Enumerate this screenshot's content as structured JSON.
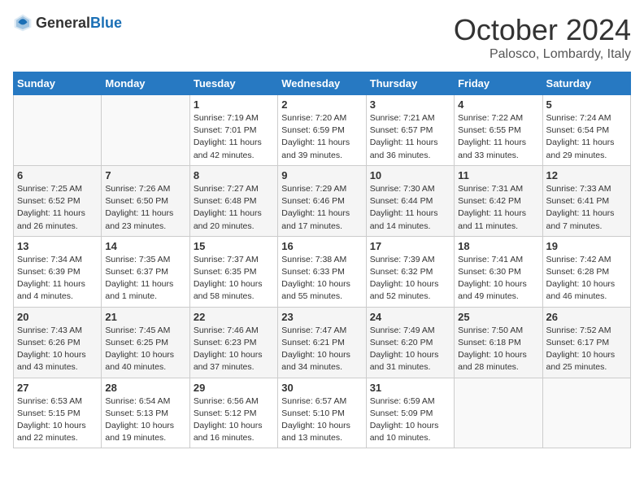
{
  "header": {
    "logo_general": "General",
    "logo_blue": "Blue",
    "month_title": "October 2024",
    "location": "Palosco, Lombardy, Italy"
  },
  "weekdays": [
    "Sunday",
    "Monday",
    "Tuesday",
    "Wednesday",
    "Thursday",
    "Friday",
    "Saturday"
  ],
  "weeks": [
    [
      {
        "day": "",
        "empty": true
      },
      {
        "day": "",
        "empty": true
      },
      {
        "day": "1",
        "sunrise": "Sunrise: 7:19 AM",
        "sunset": "Sunset: 7:01 PM",
        "daylight": "Daylight: 11 hours and 42 minutes."
      },
      {
        "day": "2",
        "sunrise": "Sunrise: 7:20 AM",
        "sunset": "Sunset: 6:59 PM",
        "daylight": "Daylight: 11 hours and 39 minutes."
      },
      {
        "day": "3",
        "sunrise": "Sunrise: 7:21 AM",
        "sunset": "Sunset: 6:57 PM",
        "daylight": "Daylight: 11 hours and 36 minutes."
      },
      {
        "day": "4",
        "sunrise": "Sunrise: 7:22 AM",
        "sunset": "Sunset: 6:55 PM",
        "daylight": "Daylight: 11 hours and 33 minutes."
      },
      {
        "day": "5",
        "sunrise": "Sunrise: 7:24 AM",
        "sunset": "Sunset: 6:54 PM",
        "daylight": "Daylight: 11 hours and 29 minutes."
      }
    ],
    [
      {
        "day": "6",
        "sunrise": "Sunrise: 7:25 AM",
        "sunset": "Sunset: 6:52 PM",
        "daylight": "Daylight: 11 hours and 26 minutes."
      },
      {
        "day": "7",
        "sunrise": "Sunrise: 7:26 AM",
        "sunset": "Sunset: 6:50 PM",
        "daylight": "Daylight: 11 hours and 23 minutes."
      },
      {
        "day": "8",
        "sunrise": "Sunrise: 7:27 AM",
        "sunset": "Sunset: 6:48 PM",
        "daylight": "Daylight: 11 hours and 20 minutes."
      },
      {
        "day": "9",
        "sunrise": "Sunrise: 7:29 AM",
        "sunset": "Sunset: 6:46 PM",
        "daylight": "Daylight: 11 hours and 17 minutes."
      },
      {
        "day": "10",
        "sunrise": "Sunrise: 7:30 AM",
        "sunset": "Sunset: 6:44 PM",
        "daylight": "Daylight: 11 hours and 14 minutes."
      },
      {
        "day": "11",
        "sunrise": "Sunrise: 7:31 AM",
        "sunset": "Sunset: 6:42 PM",
        "daylight": "Daylight: 11 hours and 11 minutes."
      },
      {
        "day": "12",
        "sunrise": "Sunrise: 7:33 AM",
        "sunset": "Sunset: 6:41 PM",
        "daylight": "Daylight: 11 hours and 7 minutes."
      }
    ],
    [
      {
        "day": "13",
        "sunrise": "Sunrise: 7:34 AM",
        "sunset": "Sunset: 6:39 PM",
        "daylight": "Daylight: 11 hours and 4 minutes."
      },
      {
        "day": "14",
        "sunrise": "Sunrise: 7:35 AM",
        "sunset": "Sunset: 6:37 PM",
        "daylight": "Daylight: 11 hours and 1 minute."
      },
      {
        "day": "15",
        "sunrise": "Sunrise: 7:37 AM",
        "sunset": "Sunset: 6:35 PM",
        "daylight": "Daylight: 10 hours and 58 minutes."
      },
      {
        "day": "16",
        "sunrise": "Sunrise: 7:38 AM",
        "sunset": "Sunset: 6:33 PM",
        "daylight": "Daylight: 10 hours and 55 minutes."
      },
      {
        "day": "17",
        "sunrise": "Sunrise: 7:39 AM",
        "sunset": "Sunset: 6:32 PM",
        "daylight": "Daylight: 10 hours and 52 minutes."
      },
      {
        "day": "18",
        "sunrise": "Sunrise: 7:41 AM",
        "sunset": "Sunset: 6:30 PM",
        "daylight": "Daylight: 10 hours and 49 minutes."
      },
      {
        "day": "19",
        "sunrise": "Sunrise: 7:42 AM",
        "sunset": "Sunset: 6:28 PM",
        "daylight": "Daylight: 10 hours and 46 minutes."
      }
    ],
    [
      {
        "day": "20",
        "sunrise": "Sunrise: 7:43 AM",
        "sunset": "Sunset: 6:26 PM",
        "daylight": "Daylight: 10 hours and 43 minutes."
      },
      {
        "day": "21",
        "sunrise": "Sunrise: 7:45 AM",
        "sunset": "Sunset: 6:25 PM",
        "daylight": "Daylight: 10 hours and 40 minutes."
      },
      {
        "day": "22",
        "sunrise": "Sunrise: 7:46 AM",
        "sunset": "Sunset: 6:23 PM",
        "daylight": "Daylight: 10 hours and 37 minutes."
      },
      {
        "day": "23",
        "sunrise": "Sunrise: 7:47 AM",
        "sunset": "Sunset: 6:21 PM",
        "daylight": "Daylight: 10 hours and 34 minutes."
      },
      {
        "day": "24",
        "sunrise": "Sunrise: 7:49 AM",
        "sunset": "Sunset: 6:20 PM",
        "daylight": "Daylight: 10 hours and 31 minutes."
      },
      {
        "day": "25",
        "sunrise": "Sunrise: 7:50 AM",
        "sunset": "Sunset: 6:18 PM",
        "daylight": "Daylight: 10 hours and 28 minutes."
      },
      {
        "day": "26",
        "sunrise": "Sunrise: 7:52 AM",
        "sunset": "Sunset: 6:17 PM",
        "daylight": "Daylight: 10 hours and 25 minutes."
      }
    ],
    [
      {
        "day": "27",
        "sunrise": "Sunrise: 6:53 AM",
        "sunset": "Sunset: 5:15 PM",
        "daylight": "Daylight: 10 hours and 22 minutes."
      },
      {
        "day": "28",
        "sunrise": "Sunrise: 6:54 AM",
        "sunset": "Sunset: 5:13 PM",
        "daylight": "Daylight: 10 hours and 19 minutes."
      },
      {
        "day": "29",
        "sunrise": "Sunrise: 6:56 AM",
        "sunset": "Sunset: 5:12 PM",
        "daylight": "Daylight: 10 hours and 16 minutes."
      },
      {
        "day": "30",
        "sunrise": "Sunrise: 6:57 AM",
        "sunset": "Sunset: 5:10 PM",
        "daylight": "Daylight: 10 hours and 13 minutes."
      },
      {
        "day": "31",
        "sunrise": "Sunrise: 6:59 AM",
        "sunset": "Sunset: 5:09 PM",
        "daylight": "Daylight: 10 hours and 10 minutes."
      },
      {
        "day": "",
        "empty": true
      },
      {
        "day": "",
        "empty": true
      }
    ]
  ]
}
